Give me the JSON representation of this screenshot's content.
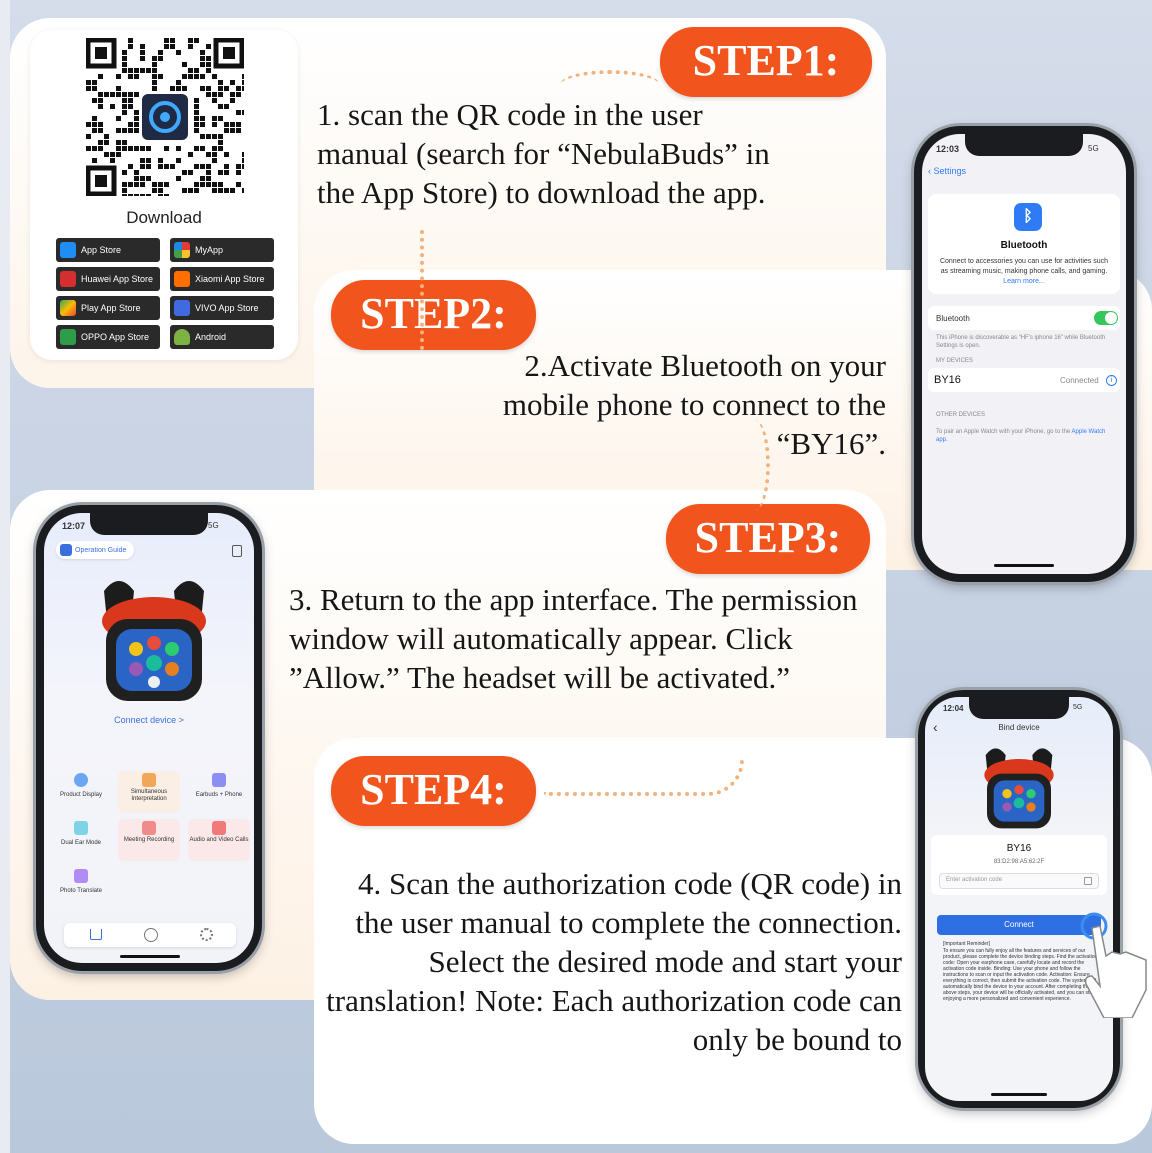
{
  "step1": {
    "badge": "STEP1:",
    "text": "1. scan the QR code in the user manual (search for “NebulaBuds” in the App Store) to download the app.",
    "download_label": "Download",
    "stores": [
      "App Store",
      "MyApp",
      "Huawei App Store",
      "Xiaomi App Store",
      "Play App Store",
      "VIVO App Store",
      "OPPO App Store",
      "Android"
    ]
  },
  "step2": {
    "badge": "STEP2:",
    "text": "2.Activate Bluetooth on your mobile phone to connect to the “BY16”."
  },
  "step3": {
    "badge": "STEP3:",
    "text": "3. Return to the app interface. The permission window will automatically appear. Click ”Allow.” The headset will be activated.”"
  },
  "step4": {
    "badge": "STEP4:",
    "text": "4. Scan the authorization code (QR code) in the user manual to complete the connection. Select the desired mode and start your translation! Note: Each authorization code can only be bound to"
  },
  "bt_phone": {
    "time": "12:03",
    "signal": "5G",
    "back": "Settings",
    "title": "Bluetooth",
    "desc": "Connect to accessories you can use for activities such as streaming music, making phone calls, and gaming.",
    "learn_more": "Learn more...",
    "toggle_label": "Bluetooth",
    "discoverable": "This iPhone is discoverable as “HF's iphone 16” while Bluetooth Settings is open.",
    "my_devices": "MY DEVICES",
    "device_name": "BY16",
    "device_status": "Connected",
    "other_devices": "OTHER DEVICES",
    "watch_note": "To pair an Apple Watch with your iPhone, go to the",
    "watch_link": "Apple Watch app."
  },
  "app_phone": {
    "time": "12:07",
    "signal": "5G",
    "guide": "Operation Guide",
    "connect": "Connect device >",
    "modes": [
      "Product Display",
      "Simultaneous Interpretation",
      "Earbuds + Phone",
      "Dual Ear Mode",
      "Meeting Recording",
      "Audio and Video Calls",
      "Photo Translate"
    ],
    "colors": {
      "accent": "#3b6fe0",
      "orange": "#f1541c"
    }
  },
  "bind_phone": {
    "time": "12:04",
    "signal": "5G",
    "title": "Bind device",
    "device": "BY16",
    "mac": "83:D2:98:A5:62:2F",
    "placeholder": "Enter activation code",
    "connect": "Connect",
    "reminder_title": "[Important Reminder]",
    "reminder": "To ensure you can fully enjoy all the features and services of our product, please complete the device binding steps. Find the activation code: Open your earphone case, carefully locate and record the activation code inside. Binding: Use your phone and follow the instructions to scan or input the activation code. Activation: Ensure everything is correct, then submit the activation code. The system will automatically bind the device to your account. After completing the above steps, your device will be officially activated, and you can start enjoying a more personalized and convenient experience."
  }
}
